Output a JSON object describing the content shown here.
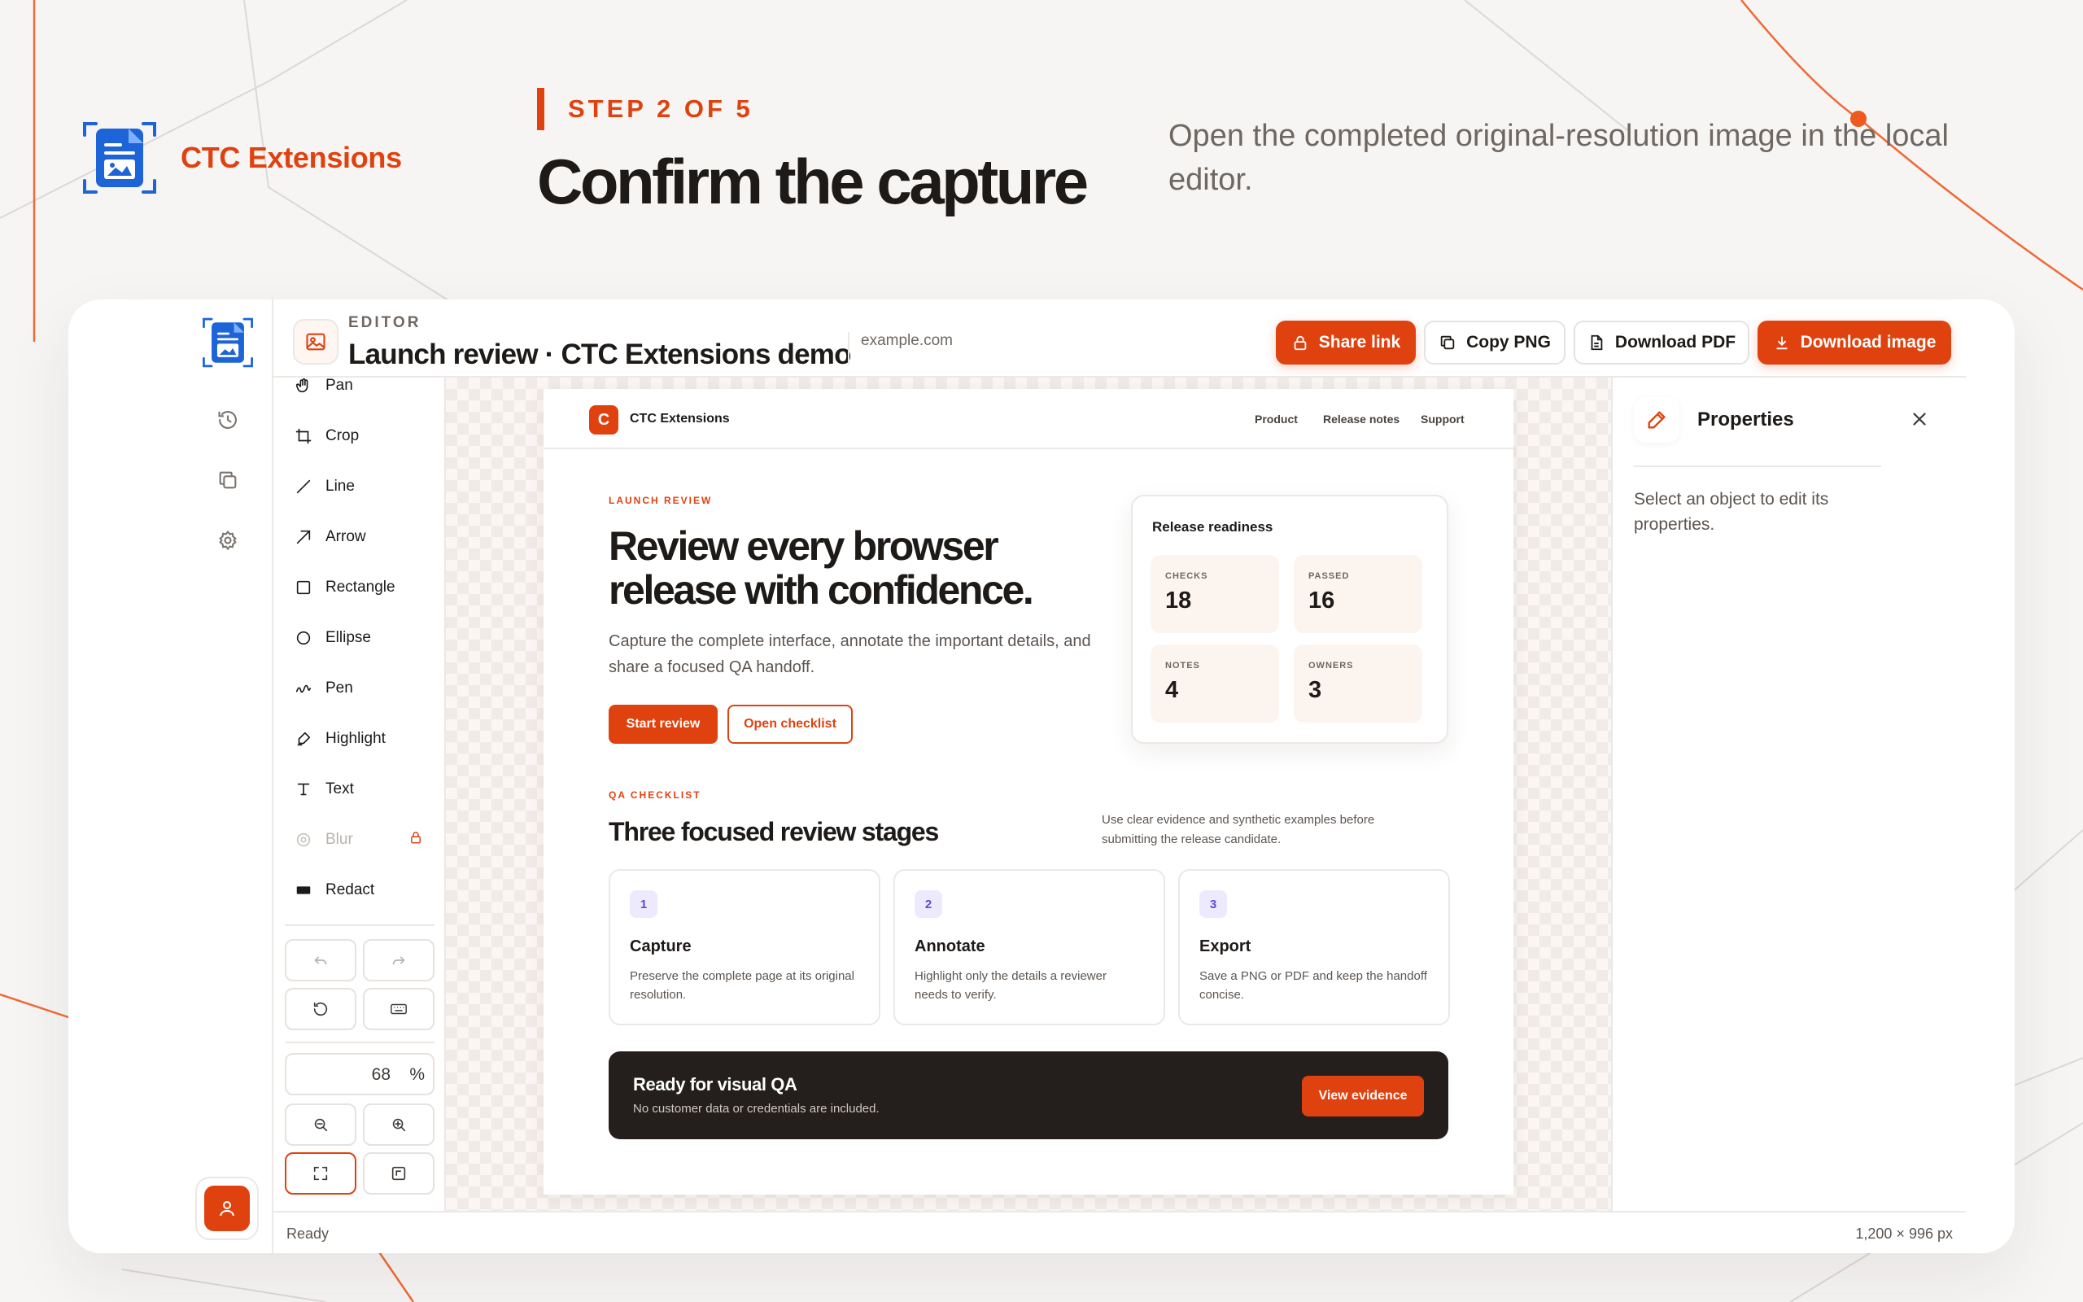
{
  "brand": {
    "name": "CTC Extensions"
  },
  "hero": {
    "step": "STEP 2 OF 5",
    "title": "Confirm the capture",
    "subtitle": "Open the completed original-resolution image in the local editor."
  },
  "colors": {
    "accent": "#e0420f",
    "dark": "#241f1c",
    "lavender": "#b8a9f5"
  },
  "editor": {
    "kicker": "EDITOR",
    "doc_title": "Launch review · CTC Extensions demo",
    "doc_url": "example.com",
    "actions": {
      "share": "Share link",
      "copy": "Copy PNG",
      "pdf": "Download PDF",
      "download": "Download image"
    },
    "rail_icons": [
      "history-icon",
      "copy-icon",
      "settings-icon",
      "user-icon"
    ],
    "tools": [
      {
        "label": "Pan",
        "icon": "hand-icon"
      },
      {
        "label": "Crop",
        "icon": "crop-icon"
      },
      {
        "label": "Line",
        "icon": "line-icon"
      },
      {
        "label": "Arrow",
        "icon": "arrow-icon"
      },
      {
        "label": "Rectangle",
        "icon": "rectangle-icon"
      },
      {
        "label": "Ellipse",
        "icon": "ellipse-icon"
      },
      {
        "label": "Pen",
        "icon": "pen-icon"
      },
      {
        "label": "Highlight",
        "icon": "highlighter-icon"
      },
      {
        "label": "Text",
        "icon": "text-icon"
      },
      {
        "label": "Blur",
        "icon": "blur-icon",
        "locked": true
      },
      {
        "label": "Redact",
        "icon": "redact-icon"
      }
    ],
    "zoom": {
      "value": "68",
      "unit": "%"
    },
    "properties": {
      "title": "Properties",
      "hint": "Select an object to edit its properties."
    },
    "status": {
      "left": "Ready",
      "right": "1,200 × 996 px"
    }
  },
  "preview": {
    "brand": "CTC Extensions",
    "logo_letter": "C",
    "nav": [
      "Product",
      "Release notes",
      "Support"
    ],
    "kicker": "LAUNCH REVIEW",
    "title": "Review every browser release with confidence.",
    "lead": "Capture the complete interface, annotate the important details, and share a focused QA handoff.",
    "buttons": {
      "primary": "Start review",
      "secondary": "Open checklist"
    },
    "readiness": {
      "title": "Release readiness",
      "stats": [
        {
          "label": "CHECKS",
          "value": "18"
        },
        {
          "label": "PASSED",
          "value": "16"
        },
        {
          "label": "NOTES",
          "value": "4"
        },
        {
          "label": "OWNERS",
          "value": "3"
        }
      ]
    },
    "checklist": {
      "kicker": "QA CHECKLIST",
      "title": "Three focused review stages",
      "note": "Use clear evidence and synthetic examples before submitting the release candidate.",
      "stages": [
        {
          "num": "1",
          "title": "Capture",
          "desc": "Preserve the complete page at its original resolution."
        },
        {
          "num": "2",
          "title": "Annotate",
          "desc": "Highlight only the details a reviewer needs to verify."
        },
        {
          "num": "3",
          "title": "Export",
          "desc": "Save a PNG or PDF and keep the handoff concise."
        }
      ]
    },
    "banner": {
      "title": "Ready for visual QA",
      "desc": "No customer data or credentials are included.",
      "button": "View evidence"
    }
  }
}
